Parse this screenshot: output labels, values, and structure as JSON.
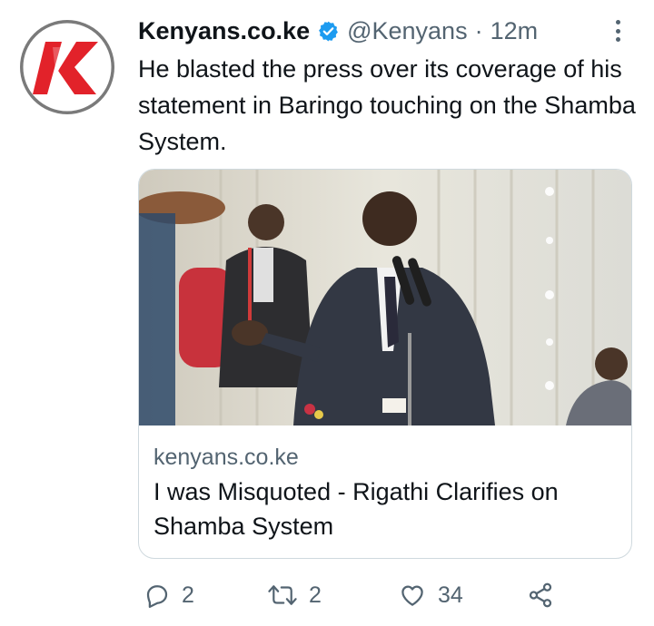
{
  "tweet": {
    "author_name": "Kenyans.co.ke",
    "handle": "@Kenyans",
    "separator": "·",
    "timestamp": "12m",
    "text": "He blasted the press over its coverage of his statement in Baringo touching on the Shamba System.",
    "verified": true
  },
  "card": {
    "domain": "kenyans.co.ke",
    "title": "I was Misquoted - Rigathi Clarifies on Shamba System"
  },
  "actions": {
    "reply_count": "2",
    "retweet_count": "2",
    "like_count": "34"
  },
  "colors": {
    "verified_badge": "#1d9bf0",
    "logo_red": "#e2222a",
    "secondary_text": "#536471"
  },
  "icons": {
    "avatar": "kenyans-logo",
    "verified": "verified-badge-icon",
    "more": "more-options-icon",
    "reply": "reply-icon",
    "retweet": "retweet-icon",
    "like": "heart-icon",
    "share": "share-icon"
  }
}
